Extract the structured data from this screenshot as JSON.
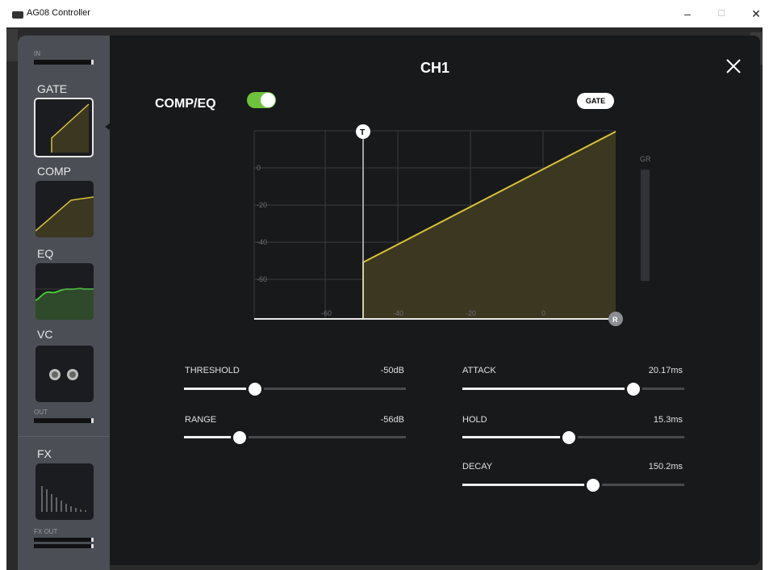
{
  "window": {
    "title": "AG08 Controller",
    "min_glyph": "–",
    "max_glyph": "☐",
    "close_glyph": "✕"
  },
  "sidebar": {
    "in_label": "IN",
    "sections": [
      {
        "label": "GATE",
        "icon": "gate-curve-icon",
        "selected": true
      },
      {
        "label": "COMP",
        "icon": "comp-curve-icon",
        "selected": false
      },
      {
        "label": "EQ",
        "icon": "eq-curve-icon",
        "selected": false
      },
      {
        "label": "VC",
        "icon": "vc-knobs-icon",
        "selected": false
      }
    ],
    "out_label": "OUT",
    "fx_label": "FX",
    "fx_out_label": "FX OUT"
  },
  "panel": {
    "channel": "CH1",
    "compeq_label": "COMP/EQ",
    "compeq_on": true,
    "gate_badge": "GATE",
    "graph": {
      "threshold_marker": "T",
      "range_marker": "R",
      "gr_label": "GR",
      "y_ticks": [
        "0",
        "-20",
        "-40",
        "-60"
      ],
      "x_ticks": [
        "-60",
        "-40",
        "-20",
        "0"
      ]
    },
    "sliders": {
      "threshold": {
        "label": "THRESHOLD",
        "value": "-50dB",
        "position": 0.32
      },
      "range": {
        "label": "RANGE",
        "value": "-56dB",
        "position": 0.25
      },
      "attack": {
        "label": "ATTACK",
        "value": "20.17ms",
        "position": 0.77
      },
      "hold": {
        "label": "HOLD",
        "value": "15.3ms",
        "position": 0.48
      },
      "decay": {
        "label": "DECAY",
        "value": "150.2ms",
        "position": 0.59
      }
    }
  },
  "colors": {
    "accent_yellow": "#d8c23a",
    "curve_fill": "#3b3720",
    "toggle_green": "#6fc23b",
    "eq_green": "#4ccf3a"
  }
}
